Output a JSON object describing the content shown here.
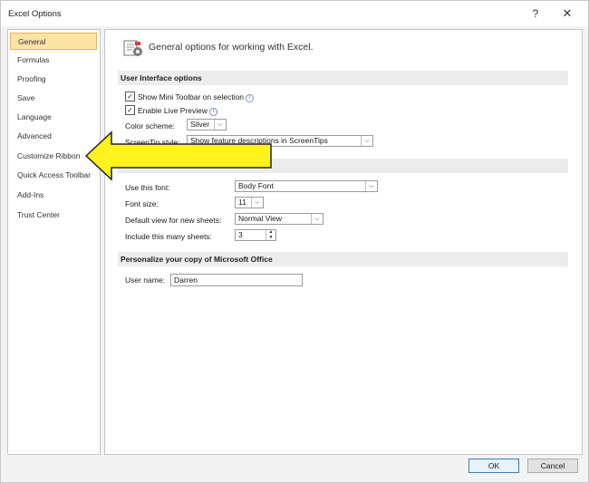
{
  "window": {
    "title": "Excel Options",
    "help_glyph": "?",
    "close_glyph": "✕"
  },
  "nav": {
    "items": [
      {
        "label": "General",
        "selected": true
      },
      {
        "label": "Formulas"
      },
      {
        "label": "Proofing"
      },
      {
        "label": "Save"
      },
      {
        "label": "Language"
      },
      {
        "label": "Advanced"
      },
      {
        "label": "Customize Ribbon"
      },
      {
        "label": "Quick Access Toolbar"
      },
      {
        "label": "Add-Ins"
      },
      {
        "label": "Trust Center"
      }
    ]
  },
  "content": {
    "header_text": "General options for working with Excel.",
    "ui_section": {
      "title": "User Interface options",
      "show_mini_toolbar": {
        "label": "Show Mini Toolbar on selection",
        "checked": true
      },
      "enable_live_preview": {
        "label": "Enable Live Preview",
        "checked": true
      },
      "color_scheme": {
        "label": "Color scheme:",
        "value": "Silver"
      },
      "screentip_style": {
        "label": "ScreenTip style:",
        "value": "Show feature descriptions in ScreenTips"
      }
    },
    "workbook_section": {
      "font": {
        "label": "Use this font:",
        "value": "Body Font"
      },
      "font_size": {
        "label": "Font size:",
        "value": "11"
      },
      "default_view": {
        "label": "Default view for new sheets:",
        "value": "Normal View"
      },
      "sheets": {
        "label": "Include this many sheets:",
        "value": "3"
      }
    },
    "personalize_section": {
      "title": "Personalize your copy of Microsoft Office",
      "user_name": {
        "label": "User name:",
        "value": "Darren"
      }
    }
  },
  "buttons": {
    "ok": "OK",
    "cancel": "Cancel"
  },
  "glyphs": {
    "check": "✓",
    "info": "i",
    "dropdown": "⌵",
    "spin_up": "▲",
    "spin_down": "▼"
  },
  "colors": {
    "selected_nav_bg": "#fce4a6",
    "arrow_fill": "#fff21f"
  }
}
